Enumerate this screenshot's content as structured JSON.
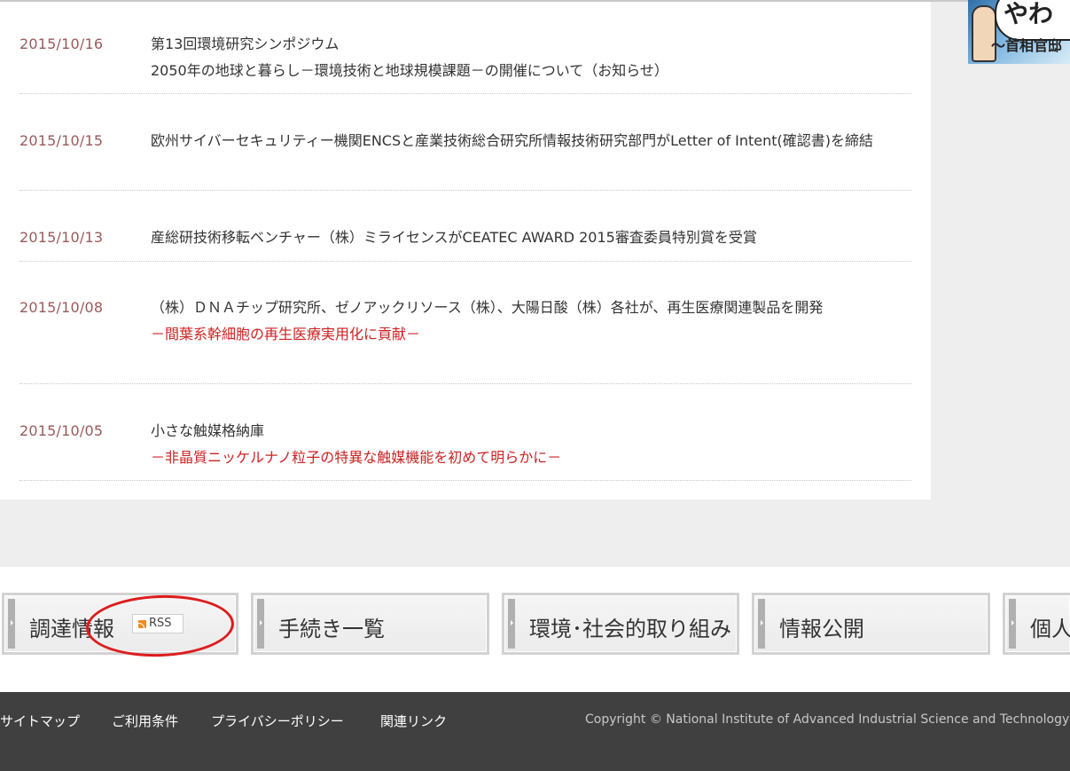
{
  "news": [
    {
      "date": "2015/10/16",
      "title": "第13回環境研究シンポジウム",
      "line2": "2050年の地球と暮らし－環境技術と地球規模課題－の開催について（お知らせ）",
      "sub": ""
    },
    {
      "date": "2015/10/15",
      "title": "欧州サイバーセキュリティー機関ENCSと産業技術総合研究所情報技術研究部門がLetter of Intent(確認書)を締結",
      "line2": "",
      "sub": ""
    },
    {
      "date": "2015/10/13",
      "title": "産総研技術移転ベンチャー（株）ミライセンスがCEATEC AWARD 2015審査委員特別賞を受賞",
      "line2": "",
      "sub": ""
    },
    {
      "date": "2015/10/08",
      "title": "（株）ＤＮＡチップ研究所、ゼノアックリソース（株）、大陽日酸（株）各社が、再生医療関連製品を開発",
      "line2": "",
      "sub": "－間葉系幹細胞の再生医療実用化に貢献－"
    },
    {
      "date": "2015/10/05",
      "title": "小さな触媒格納庫",
      "line2": "",
      "sub": "－非晶質ニッケルナノ粒子の特異な触媒機能を初めて明らかに－"
    }
  ],
  "banner": {
    "text_top": "やわ",
    "text_bottom": "〜首相官邸"
  },
  "nav_tiles": [
    {
      "label": "調達情報",
      "badge": "RSS"
    },
    {
      "label": "手続き一覧"
    },
    {
      "label": "環境･社会的取り組み"
    },
    {
      "label": "情報公開"
    },
    {
      "label": "個人"
    }
  ],
  "footer": {
    "links": [
      "サイトマップ",
      "ご利用条件",
      "プライバシーポリシー",
      "関連リンク"
    ],
    "copyright": "Copyright © National Institute of Advanced Industrial Science and Technology"
  },
  "colors": {
    "date": "#9a5a5a",
    "sub_red": "#cc2222",
    "annotation": "#dd1c1c",
    "footer_bg": "#404040"
  }
}
